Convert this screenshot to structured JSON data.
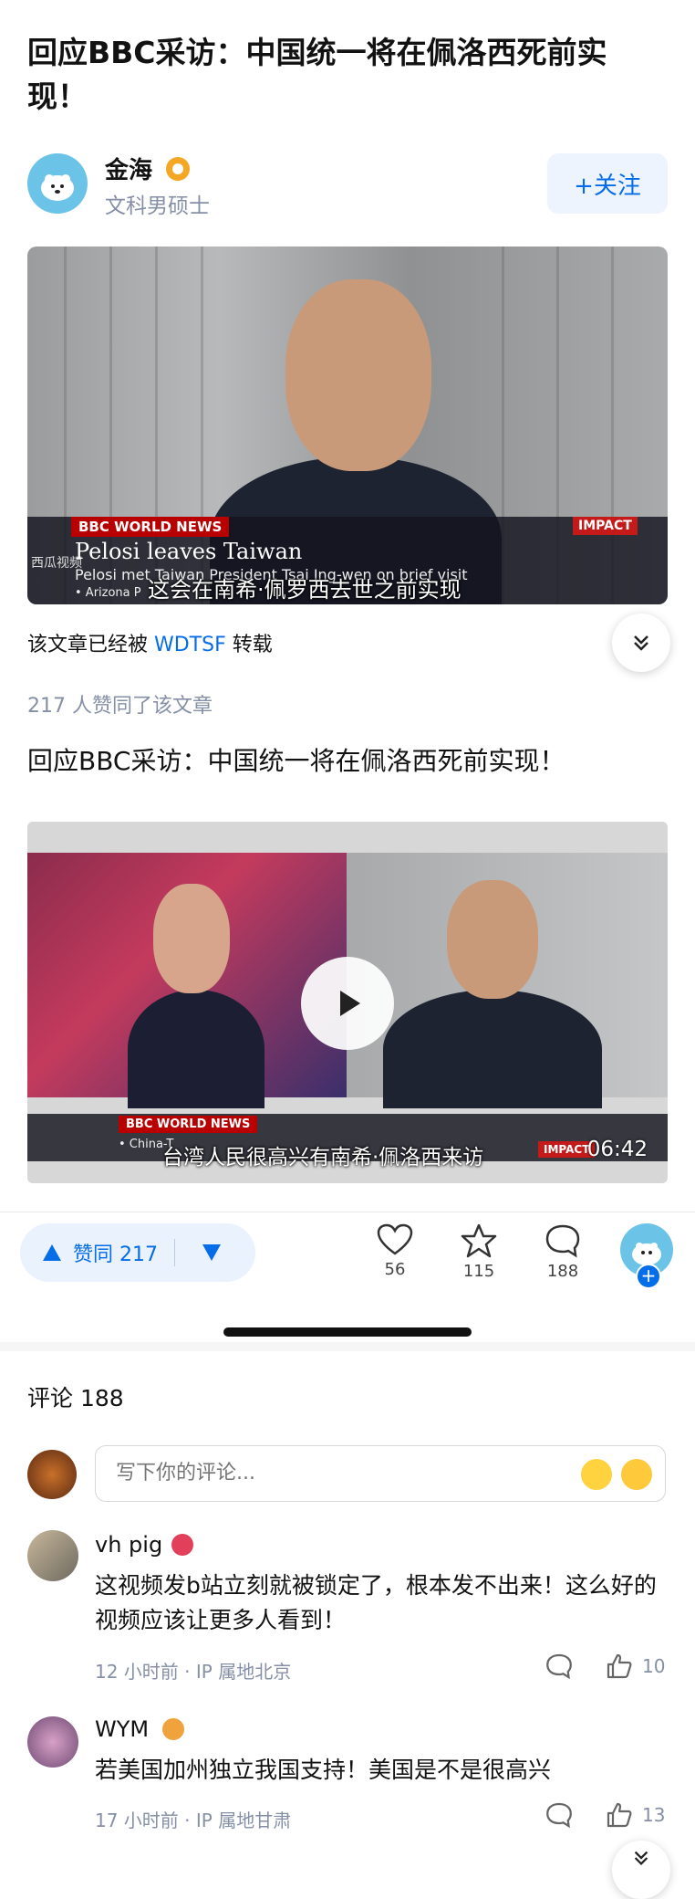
{
  "article": {
    "title": "回应BBC采访：中国统一将在佩洛西死前实现！",
    "author_name": "金海",
    "author_subtitle": "文科男硕士",
    "follow_label": "+关注",
    "repost_prefix": "该文章已经被",
    "repost_user": "WDTSF",
    "repost_suffix": "转载",
    "likes_line": "217 人赞同了该文章",
    "body_text": "回应BBC采访：中国统一将在佩洛西死前实现！"
  },
  "video1": {
    "bbc_tag": "BBC WORLD NEWS",
    "impact": "IMPACT",
    "headline": "Pelosi leaves Taiwan",
    "subline": "Pelosi met Taiwan President Tsai Ing-wen on brief visit",
    "ticker": "• Arizona P",
    "watermark": "西瓜视频",
    "caption": "这会在南希·佩罗西去世之前实现"
  },
  "video2": {
    "bbc_tag": "BBC WORLD NEWS",
    "ticker": "• China-T",
    "impact": "IMPACT",
    "caption": "台湾人民很高兴有南希·佩洛西来访",
    "duration": "06:42"
  },
  "actions": {
    "vote_up_label": "赞同 217",
    "like_count": "56",
    "star_count": "115",
    "comment_count": "188"
  },
  "comments": {
    "title": "评论 188",
    "input_placeholder": "写下你的评论...",
    "items": [
      {
        "name": "vh pig",
        "text": "这视频发b站立刻就被锁定了，根本发不出来！这么好的视频应该让更多人看到！",
        "meta": "12 小时前 · IP 属地北京",
        "likes": "10"
      },
      {
        "name": "WYM",
        "text": "若美国加州独立我国支持！美国是不是很高兴",
        "meta": "17 小时前 · IP 属地甘肃",
        "likes": "13"
      }
    ]
  },
  "colors": {
    "accent": "#056de8",
    "muted": "#8590a6",
    "bbc_red": "#b80000"
  }
}
